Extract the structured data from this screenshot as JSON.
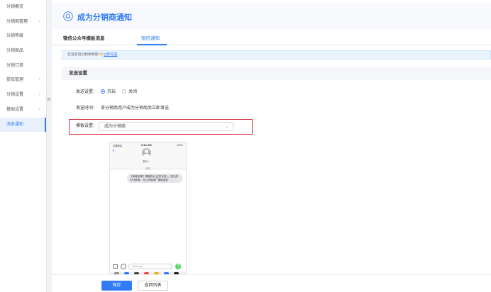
{
  "sidebar": {
    "items": [
      {
        "label": "分销概览",
        "has_children": false,
        "active": false
      },
      {
        "label": "分销商管理",
        "has_children": true,
        "active": false
      },
      {
        "label": "分销等级",
        "has_children": false,
        "active": false
      },
      {
        "label": "分销商品",
        "has_children": false,
        "active": false
      },
      {
        "label": "分销订单",
        "has_children": false,
        "active": false
      },
      {
        "label": "提现管理",
        "has_children": true,
        "active": false
      },
      {
        "label": "分销设置",
        "has_children": true,
        "active": false
      },
      {
        "label": "基础设置",
        "has_children": true,
        "active": false
      },
      {
        "label": "消息通知",
        "has_children": false,
        "active": true
      }
    ],
    "chevron": "›",
    "collapse_glyph": "≡"
  },
  "header": {
    "title": "成为分销商通知",
    "icon": "bell-icon"
  },
  "tabs": [
    {
      "label": "微信公众号模板消息",
      "active": false
    },
    {
      "label": "短信通知",
      "active": true
    }
  ],
  "notice": {
    "text": "您当前短信剩余数量",
    "count": "0",
    "unit": "条",
    "link": "立即充值"
  },
  "section": {
    "title": "发送设置"
  },
  "form": {
    "send_setting": {
      "label": "发送设置：",
      "options": [
        "开启",
        "关闭"
      ],
      "selected": "开启"
    },
    "send_time": {
      "label": "发送时间：",
      "value": "非分销商用户成为分销商后立即发送"
    },
    "template": {
      "label": "模板设置：",
      "value": "成为分销商"
    }
  },
  "phone": {
    "carrier": "中国移动",
    "time": "9:41 AM",
    "battery": "100%",
    "contact": "联系人",
    "message_meta": "短信",
    "message": "【商城名称】尊敬的${会员名称}，您已成为分销商，可以开始推广赚佣金啦",
    "input_placeholder": "iMessage",
    "send_glyph": "↑"
  },
  "footer": {
    "save_label": "保存",
    "back_label": "返回列表"
  },
  "colors": {
    "accent": "#2f7cf6",
    "highlight": "#d9363e",
    "warn": "#f0932b"
  }
}
